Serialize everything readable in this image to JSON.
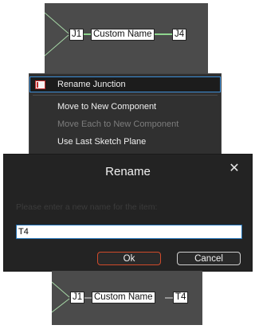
{
  "canvas_top": {
    "left_node": "J1",
    "middle_node": "Custom Name",
    "right_node": "J4"
  },
  "context_menu": {
    "items": [
      {
        "label": "Rename Junction",
        "highlighted": true,
        "disabled": false,
        "icon": "rename-icon"
      },
      {
        "label": "Move to New Component",
        "highlighted": false,
        "disabled": false
      },
      {
        "label": "Move Each to New Component",
        "highlighted": false,
        "disabled": true
      },
      {
        "label": "Use Last Sketch Plane",
        "highlighted": false,
        "disabled": false
      }
    ]
  },
  "dialog": {
    "title": "Rename",
    "close_glyph": "✕",
    "prompt": "Please enter a new name for the item:",
    "input_value": "T4",
    "ok_label": "Ok",
    "cancel_label": "Cancel"
  },
  "canvas_bottom": {
    "left_node": "J1",
    "middle_node": "Custom Name",
    "right_node": "T4"
  },
  "colors": {
    "canvas_bg": "#4b4b4b",
    "menu_bg": "#303030",
    "dialog_bg": "#232323",
    "highlight_border": "#3d8fd9",
    "ok_border": "#d04a2a"
  }
}
